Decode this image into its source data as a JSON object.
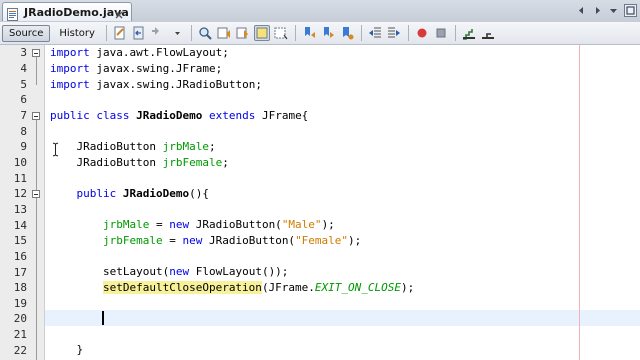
{
  "tab": {
    "title": "JRadioDemo.java"
  },
  "toolbar": {
    "source_label": "Source",
    "history_label": "History",
    "icons": [
      "last-edit-icon",
      "back-icon",
      "forward-icon",
      "find-selection-icon",
      "find-previous-icon",
      "find-next-icon",
      "toggle-highlight-icon",
      "toggle-rect-select-icon",
      "previous-bookmark-icon",
      "next-bookmark-icon",
      "toggle-bookmark-icon",
      "shift-left-icon",
      "shift-right-icon",
      "start-macro-icon",
      "stop-macro-icon",
      "comment-icon",
      "uncomment-icon"
    ]
  },
  "editor": {
    "line_numbers": [
      "3",
      "4",
      "5",
      "6",
      "7",
      "8",
      "9",
      "10",
      "11",
      "12",
      "13",
      "14",
      "15",
      "16",
      "17",
      "18",
      "19",
      "20",
      "21",
      "22"
    ],
    "lines": {
      "l3_kw": "import",
      "l3_rest": " java.awt.FlowLayout;",
      "l4_kw": "import",
      "l4_rest": " javax.swing.JFrame;",
      "l5_kw": "import",
      "l5_rest": " javax.swing.JRadioButton;",
      "l7_kw1": "public class",
      "l7_name": "JRadioDemo",
      "l7_kw2": "extends",
      "l7_rest": " JFrame{",
      "l9_type": "    JRadioButton ",
      "l9_field": "jrbMale",
      "l9_end": ";",
      "l10_type": "    JRadioButton ",
      "l10_field": "jrbFemale",
      "l10_end": ";",
      "l12_kw": "    public",
      "l12_name": "JRadioDemo",
      "l12_rest": "(){",
      "l14_field": "jrbMale",
      "l14_mid": " = ",
      "l14_kw": "new",
      "l14_type": " JRadioButton(",
      "l14_str": "\"Male\"",
      "l14_end": ");",
      "l15_field": "jrbFemale",
      "l15_mid": " = ",
      "l15_kw": "new",
      "l15_type": " JRadioButton(",
      "l15_str": "\"Female\"",
      "l15_end": ");",
      "l17_start": "setLayout(",
      "l17_kw": "new",
      "l17_rest": " FlowLayout());",
      "l18_method": "setDefaultCloseOperation",
      "l18_mid": "(JFrame.",
      "l18_const": "EXIT_ON_CLOSE",
      "l18_end": ");",
      "l22_text": "}"
    }
  },
  "colors": {
    "keyword": "#0000e6",
    "field": "#009900",
    "string": "#ce7b00",
    "highlight": "#f7f29a",
    "current_line": "#e8f2fe"
  }
}
